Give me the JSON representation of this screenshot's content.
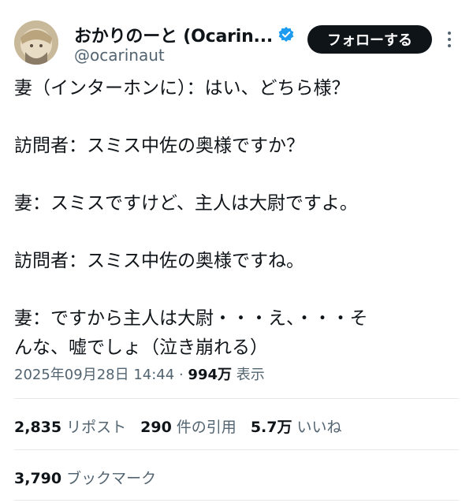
{
  "author": {
    "display_name": "おかりのーと (Ocarin...",
    "handle": "@ocarinaut",
    "verified_icon": "verified-badge-icon",
    "follow_label": "フォローする"
  },
  "tweet": {
    "lines": [
      "妻（インターホンに）：はい、どちら様？",
      "訪問者：スミス中佐の奥様ですか？",
      "妻：スミスですけど、主人は大尉ですよ。",
      "訪問者：スミス中佐の奥様ですね。",
      "妻：ですから主人は大尉・・・え、・・・そ",
      "んな、嘘でしょ（泣き崩れる）"
    ],
    "timestamp": "2025年09月28日 14:44",
    "separator": "·",
    "views_count": "994万",
    "views_label": "表示"
  },
  "stats": {
    "reposts_count": "2,835",
    "reposts_label": "リポスト",
    "quotes_count": "290",
    "quotes_label": "件の引用",
    "likes_count": "5.7万",
    "likes_label": "いいね",
    "bookmarks_count": "3,790",
    "bookmarks_label": "ブックマーク"
  },
  "colors": {
    "text": "#0f1419",
    "secondary": "#536471",
    "verified": "#1d9bf0",
    "button_bg": "#0f1419",
    "divider": "#e6e9ec"
  }
}
